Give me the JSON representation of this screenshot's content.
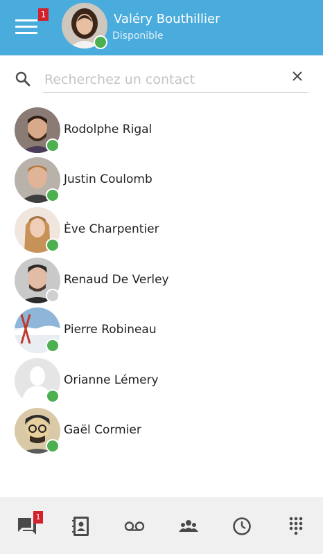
{
  "header": {
    "menu_badge": "1",
    "user_name": "Valéry Bouthillier",
    "user_status": "Disponible"
  },
  "search": {
    "placeholder": "Recherchez un contact",
    "value": ""
  },
  "contacts": [
    {
      "name": "Rodolphe Rigal",
      "status": "online"
    },
    {
      "name": "Justin Coulomb",
      "status": "online"
    },
    {
      "name": "Ève Charpentier",
      "status": "online"
    },
    {
      "name": "Renaud De Verley",
      "status": "offline"
    },
    {
      "name": "Pierre Robineau",
      "status": "online"
    },
    {
      "name": "Orianne Lémery",
      "status": "online"
    },
    {
      "name": "Gaël Cormier",
      "status": "online"
    }
  ],
  "bottom_nav": {
    "chat_badge": "1",
    "tabs": [
      "chat-icon",
      "contacts-book-icon",
      "voicemail-icon",
      "group-icon",
      "history-clock-icon",
      "dialpad-icon"
    ]
  },
  "colors": {
    "header": "#4aacdc",
    "online": "#4caf50",
    "offline": "#d0d0d0",
    "badge": "#d4202b",
    "nav_icon": "#4a4a4a"
  }
}
